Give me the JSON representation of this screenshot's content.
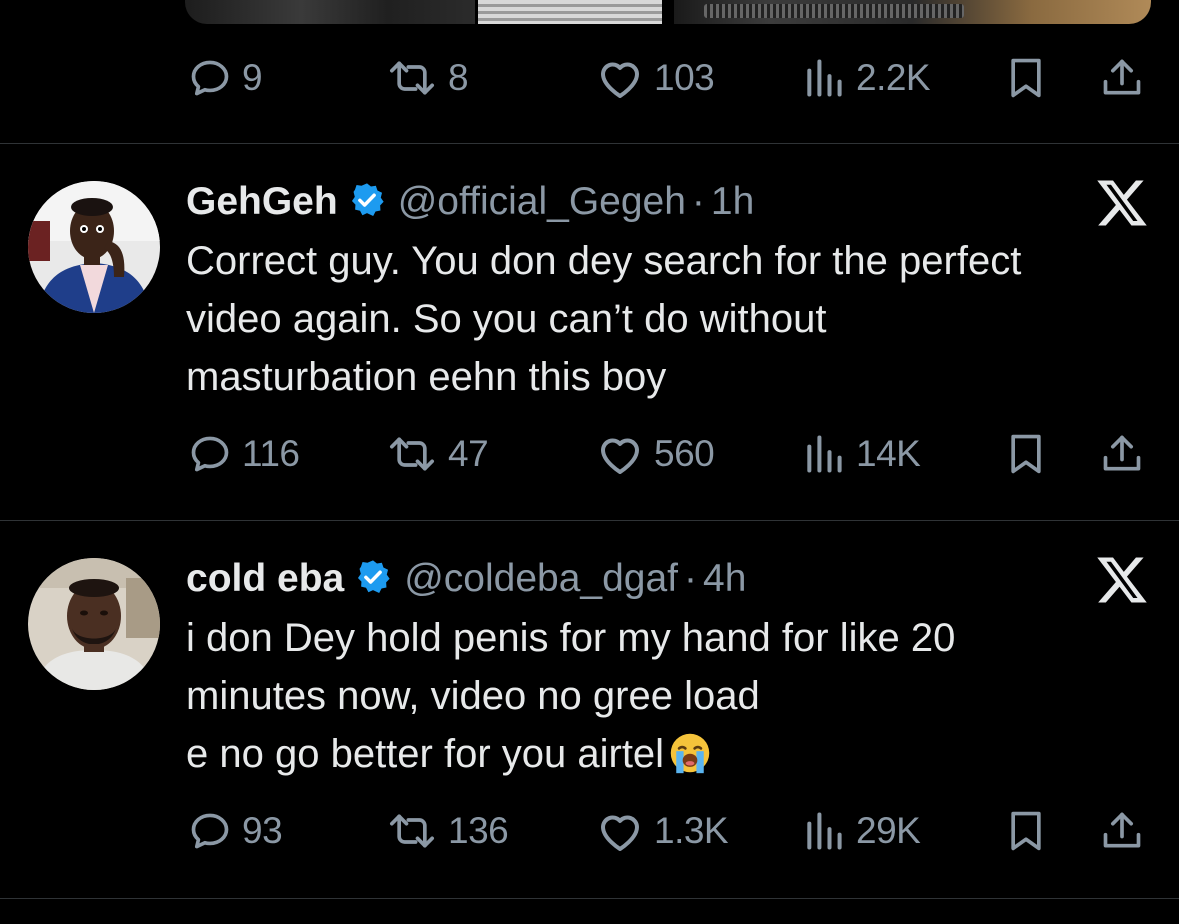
{
  "top_tweet": {
    "actions": {
      "replies": "9",
      "retweets": "8",
      "likes": "103",
      "views": "2.2K"
    }
  },
  "tweets": [
    {
      "name": "GehGeh",
      "handle": "@official_Gegeh",
      "separator": "·",
      "time": "1h",
      "lines": [
        "Correct guy. You don dey search for the perfect",
        "video again. So you can’t do without",
        "masturbation eehn this boy"
      ],
      "actions": {
        "replies": "116",
        "retweets": "47",
        "likes": "560",
        "views": "14K"
      }
    },
    {
      "name": "cold eba",
      "handle": "@coldeba_dgaf",
      "separator": "·",
      "time": "4h",
      "lines": [
        "i don Dey hold penis for my hand for like 20",
        "minutes now, video no gree load",
        "e no go better for you airtel"
      ],
      "emoji": "loudly-crying-face",
      "actions": {
        "replies": "93",
        "retweets": "136",
        "likes": "1.3K",
        "views": "29K"
      }
    }
  ],
  "colors": {
    "background": "#000000",
    "text": "#e7e9ea",
    "muted": "#8b98a5",
    "verified": "#1d9bf0",
    "divider": "#2f3336"
  },
  "icons": [
    "reply-icon",
    "retweet-icon",
    "like-icon",
    "views-icon",
    "bookmark-icon",
    "share-icon",
    "verified-badge-icon",
    "x-logo-icon"
  ]
}
